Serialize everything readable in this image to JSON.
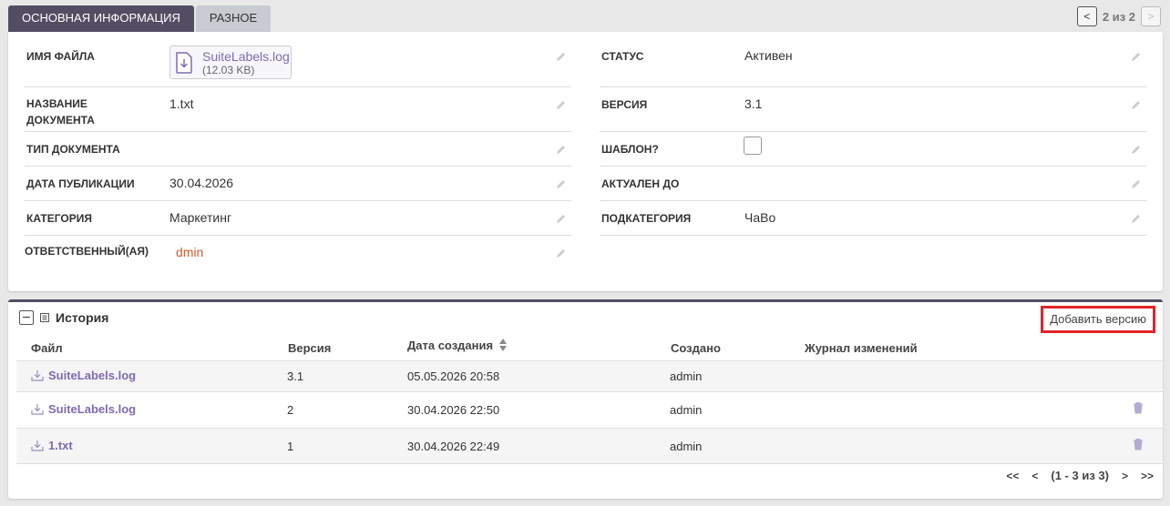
{
  "tabs": [
    {
      "label": "ОСНОВНАЯ ИНФОРМАЦИЯ",
      "active": true
    },
    {
      "label": "РАЗНОЕ",
      "active": false
    }
  ],
  "record_pager": {
    "prev": "<",
    "count": "2 из 2",
    "next": ">"
  },
  "details": {
    "left": [
      {
        "label": "ИМЯ ФАЙЛА",
        "file_name": "SuiteLabels.log",
        "file_size": "(12.03 KB)"
      },
      {
        "label": "НАЗВАНИЕ ДОКУМЕНТА",
        "value": "1.txt"
      },
      {
        "label": "ТИП ДОКУМЕНТА",
        "value": ""
      },
      {
        "label": "ДАТА ПУБЛИКАЦИИ",
        "value": "30.04.2026"
      },
      {
        "label": "КАТЕГОРИЯ",
        "value": "Маркетинг"
      },
      {
        "label": "ОТВЕТСТВЕННЫЙ(АЯ)",
        "value": "dmin"
      }
    ],
    "right": [
      {
        "label": "СТАТУС",
        "value": "Активен"
      },
      {
        "label": "ВЕРСИЯ",
        "value": "3.1"
      },
      {
        "label": "ШАБЛОН?",
        "value": ""
      },
      {
        "label": "АКТУАЛЕН ДО",
        "value": ""
      },
      {
        "label": "ПОДКАТЕГОРИЯ",
        "value": "ЧаВо"
      }
    ]
  },
  "history": {
    "title": "История",
    "add_button": "Добавить версию",
    "columns": [
      "Файл",
      "Версия",
      "Дата создания",
      "Создано",
      "Журнал изменений"
    ],
    "rows": [
      {
        "file": "SuiteLabels.log",
        "version": "3.1",
        "date": "05.05.2026 20:58",
        "created_by": "admin",
        "log": "",
        "deletable": false
      },
      {
        "file": "SuiteLabels.log",
        "version": "2",
        "date": "30.04.2026 22:50",
        "created_by": "admin",
        "log": "",
        "deletable": true
      },
      {
        "file": "1.txt",
        "version": "1",
        "date": "30.04.2026 22:49",
        "created_by": "admin",
        "log": "",
        "deletable": true
      }
    ],
    "pager": {
      "first": "<<",
      "prev": "<",
      "range": "(1 - 3 из 3)",
      "next": ">",
      "last": ">>"
    }
  },
  "colors": {
    "accent": "#534d64",
    "link": "#7e6bb0",
    "highlight": "#e3232a",
    "assigned_user": "#d4572a"
  }
}
